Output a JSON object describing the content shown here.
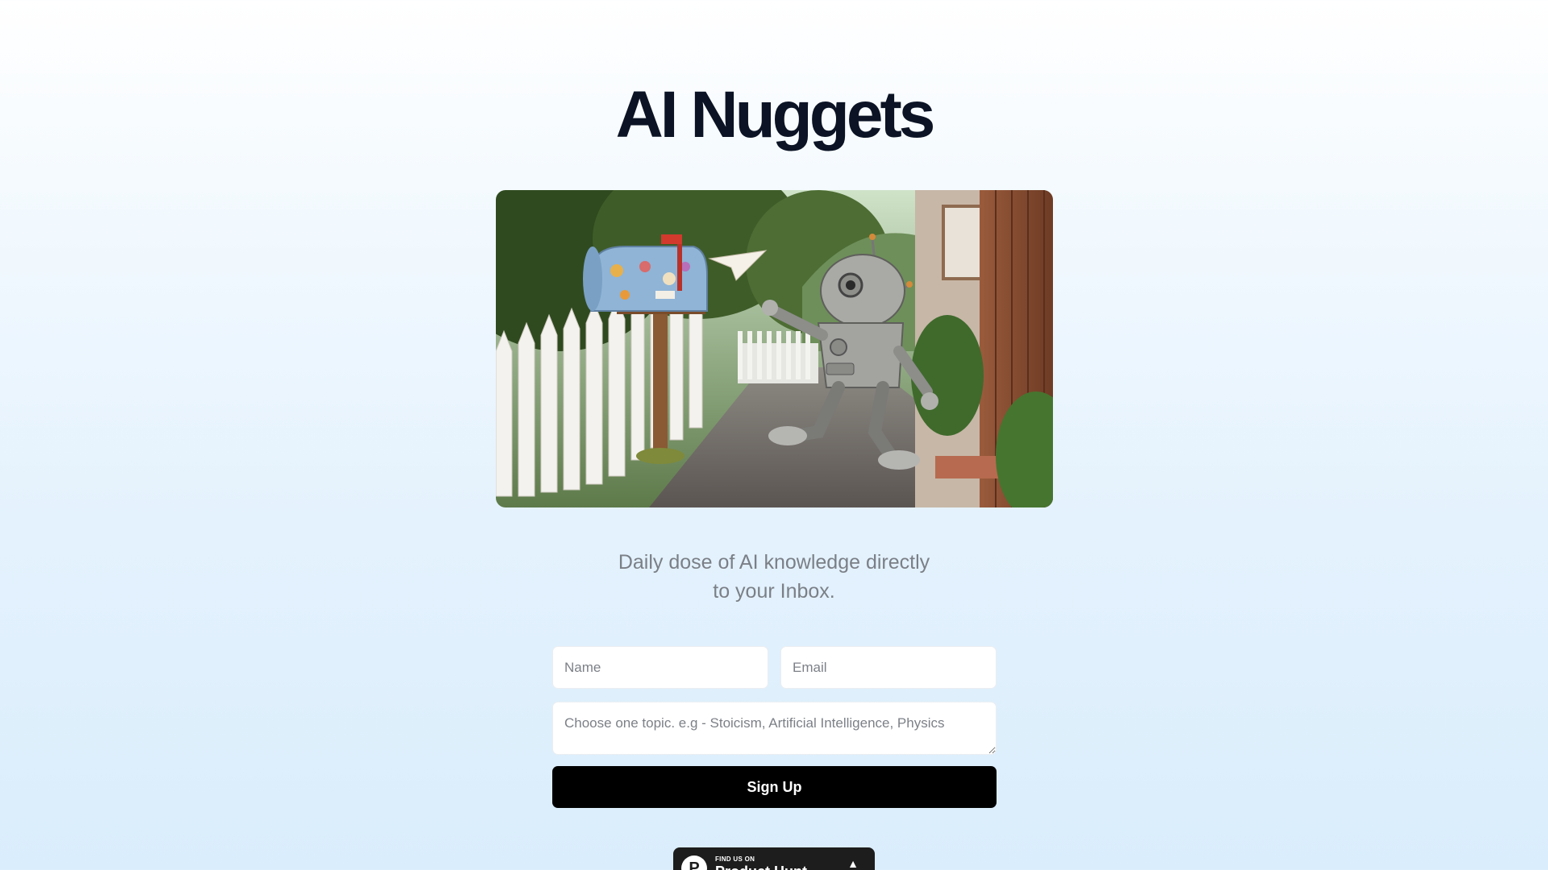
{
  "page": {
    "title": "AI Nuggets",
    "hero_image": "robot delivering paper plane to mailbox illustration",
    "tagline_line1": "Daily dose of AI knowledge directly",
    "tagline_line2": "to your Inbox."
  },
  "form": {
    "name_placeholder": "Name",
    "email_placeholder": "Email",
    "topic_placeholder": "Choose one topic. e.g - Stoicism, Artificial Intelligence, Physics",
    "submit_label": "Sign Up"
  },
  "badge": {
    "small_text": "FIND US ON",
    "big_text": "Product Hunt",
    "logo_letter": "P",
    "arrow": "▲"
  },
  "colors": {
    "title": "#0b1324",
    "tagline": "#7b7f86",
    "button_bg": "#000000",
    "button_text": "#ffffff",
    "badge_bg": "#1d1d1d"
  }
}
